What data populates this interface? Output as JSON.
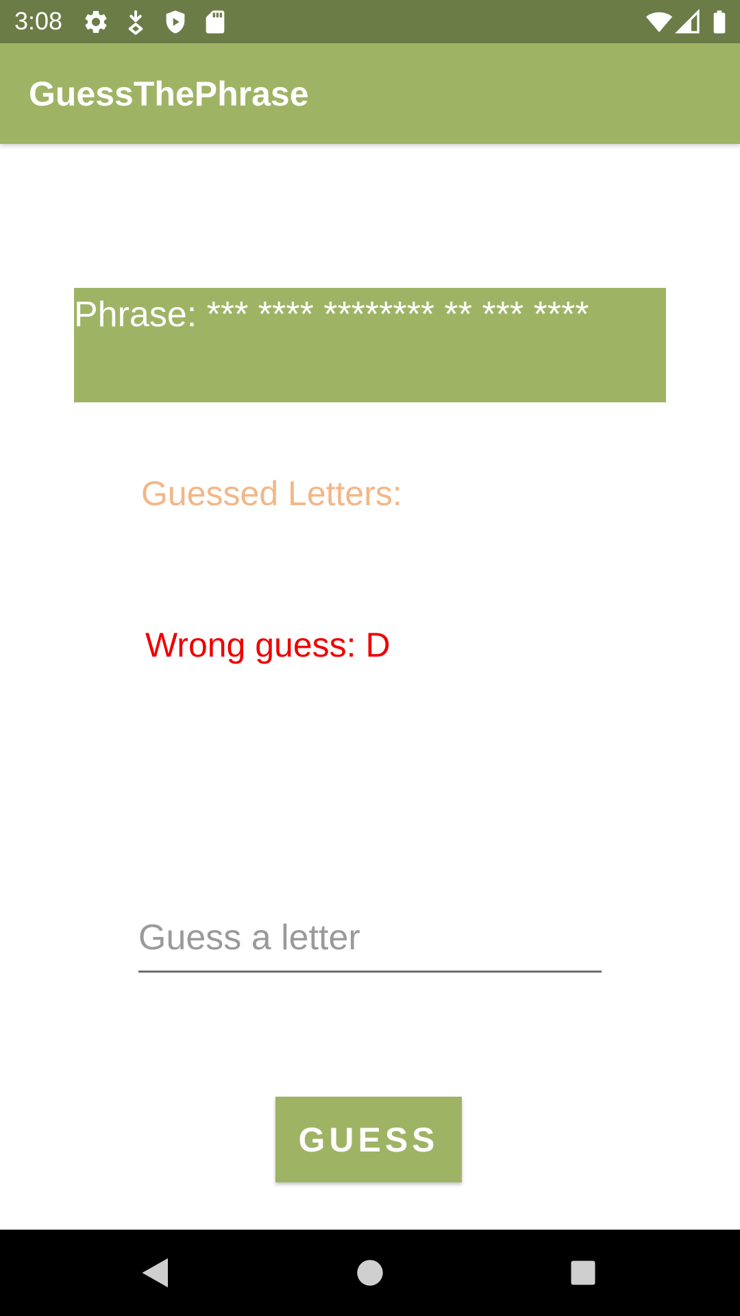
{
  "status_bar": {
    "time": "3:08",
    "left_icons": [
      "gear-icon",
      "download-icon",
      "shield-icon",
      "sd-card-icon"
    ],
    "right_icons": [
      "wifi-icon",
      "cell-signal-icon",
      "battery-icon"
    ],
    "color": "#6b7c47"
  },
  "app_bar": {
    "title": "GuessThePhrase",
    "color": "#9fb365"
  },
  "main": {
    "phrase_text": "Phrase: *** **** ******** ** *** ****",
    "guessed_letters_label": "Guessed Letters:",
    "wrong_guess_text": "Wrong guess: D",
    "guess_input": {
      "value": "",
      "placeholder": "Guess a letter"
    },
    "guess_button_label": "GUESS"
  },
  "nav_bar": {
    "buttons": [
      "back-icon",
      "home-icon",
      "recents-icon"
    ]
  },
  "colors": {
    "accent": "#9fb365",
    "guessed_label": "#f3b686",
    "wrong_guess": "#ee0000"
  }
}
